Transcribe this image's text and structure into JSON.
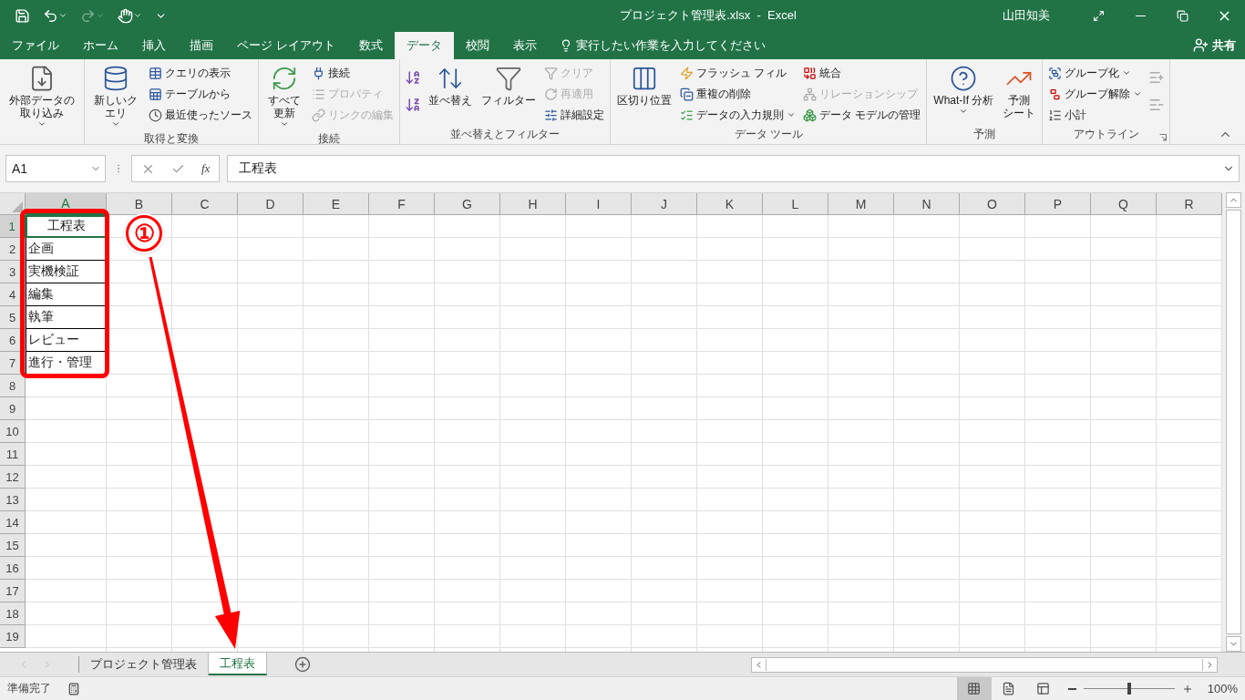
{
  "title_bar": {
    "title": "プロジェクト管理表.xlsx  -  Excel",
    "user": "山田知美",
    "redo_disabled": true
  },
  "ribbon_tabs": [
    {
      "label": "ファイル",
      "selected": false
    },
    {
      "label": "ホーム",
      "selected": false
    },
    {
      "label": "挿入",
      "selected": false
    },
    {
      "label": "描画",
      "selected": false
    },
    {
      "label": "ページ レイアウト",
      "selected": false
    },
    {
      "label": "数式",
      "selected": false
    },
    {
      "label": "データ",
      "selected": true
    },
    {
      "label": "校閲",
      "selected": false
    },
    {
      "label": "表示",
      "selected": false
    }
  ],
  "tell_me": {
    "placeholder": "実行したい作業を入力してください"
  },
  "share": "共有",
  "ribbon_groups": [
    {
      "columns": [
        [
          {
            "label": "外部データの取り込み",
            "kind": "large",
            "dropdown": true,
            "disabled": false
          }
        ]
      ]
    },
    {
      "label": "取得と変換",
      "columns": [
        [
          {
            "label": "新しいクエリ",
            "kind": "large",
            "dropdown": true,
            "disabled": false
          }
        ],
        [
          {
            "label": "クエリの表示",
            "kind": "small",
            "dropdown": false,
            "disabled": false
          },
          {
            "label": "テーブルから",
            "kind": "small",
            "dropdown": false,
            "disabled": false
          },
          {
            "label": "最近使ったソース",
            "kind": "small",
            "dropdown": false,
            "disabled": false
          }
        ]
      ]
    },
    {
      "label": "接続",
      "columns": [
        [
          {
            "label": "すべて更新",
            "kind": "large",
            "dropdown": true,
            "disabled": false
          }
        ],
        [
          {
            "label": "接続",
            "kind": "small",
            "dropdown": false,
            "disabled": false
          },
          {
            "label": "プロパティ",
            "kind": "small",
            "dropdown": false,
            "disabled": true
          },
          {
            "label": "リンクの編集",
            "kind": "small",
            "dropdown": false,
            "disabled": true
          }
        ]
      ]
    },
    {
      "label": "並べ替えとフィルター",
      "columns": [
        [
          {
            "kind": "icon",
            "disabled": false
          },
          {
            "kind": "icon",
            "disabled": false
          }
        ],
        [
          {
            "label": "並べ替え",
            "kind": "large",
            "dropdown": false,
            "disabled": false
          }
        ],
        [
          {
            "label": "フィルター",
            "kind": "large",
            "dropdown": false,
            "disabled": false
          }
        ],
        [
          {
            "label": "クリア",
            "kind": "small",
            "dropdown": false,
            "disabled": true
          },
          {
            "label": "再適用",
            "kind": "small",
            "dropdown": false,
            "disabled": true
          },
          {
            "label": "詳細設定",
            "kind": "small",
            "dropdown": false,
            "disabled": false
          }
        ]
      ]
    },
    {
      "label": "データ ツール",
      "columns": [
        [
          {
            "label": "区切り位置",
            "kind": "large",
            "dropdown": false,
            "disabled": false
          }
        ],
        [
          {
            "label": "フラッシュ フィル",
            "kind": "small",
            "dropdown": false,
            "disabled": false
          },
          {
            "label": "重複の削除",
            "kind": "small",
            "dropdown": false,
            "disabled": false
          },
          {
            "label": "データの入力規則",
            "kind": "small",
            "dropdown": true,
            "disabled": false
          }
        ],
        [
          {
            "label": "統合",
            "kind": "small",
            "dropdown": false,
            "disabled": false
          },
          {
            "label": "リレーションシップ",
            "kind": "small",
            "dropdown": false,
            "disabled": true
          },
          {
            "label": "データ モデルの管理",
            "kind": "small",
            "dropdown": false,
            "disabled": false
          }
        ]
      ]
    },
    {
      "label": "予測",
      "columns": [
        [
          {
            "label": "What-If 分析",
            "kind": "large",
            "dropdown": true,
            "disabled": false
          }
        ],
        [
          {
            "lines": [
              "予測",
              "シート"
            ],
            "kind": "large",
            "dropdown": false,
            "disabled": false
          }
        ]
      ]
    },
    {
      "label": "アウトライン",
      "launcher": true,
      "columns": [
        [
          {
            "label": "グループ化",
            "kind": "small",
            "dropdown": true,
            "disabled": false
          },
          {
            "label": "グループ解除",
            "kind": "small",
            "dropdown": true,
            "disabled": false
          },
          {
            "label": "小計",
            "kind": "small",
            "dropdown": false,
            "disabled": false
          }
        ],
        [
          {
            "kind": "icon",
            "disabled": true
          },
          {
            "kind": "icon",
            "disabled": true
          }
        ]
      ]
    }
  ],
  "formula_bar": {
    "name_box": "A1",
    "function_label": "fx",
    "formula": "工程表"
  },
  "columns": [
    {
      "label": "A",
      "selected": true
    },
    {
      "label": "B",
      "selected": false
    },
    {
      "label": "C",
      "selected": false
    },
    {
      "label": "D",
      "selected": false
    },
    {
      "label": "E",
      "selected": false
    },
    {
      "label": "F",
      "selected": false
    },
    {
      "label": "G",
      "selected": false
    },
    {
      "label": "H",
      "selected": false
    },
    {
      "label": "I",
      "selected": false
    },
    {
      "label": "J",
      "selected": false
    },
    {
      "label": "K",
      "selected": false
    },
    {
      "label": "L",
      "selected": false
    },
    {
      "label": "M",
      "selected": false
    },
    {
      "label": "N",
      "selected": false
    },
    {
      "label": "O",
      "selected": false
    },
    {
      "label": "P",
      "selected": false
    },
    {
      "label": "Q",
      "selected": false
    },
    {
      "label": "R",
      "selected": false
    }
  ],
  "rows": [
    {
      "number": "1",
      "selected": true,
      "cells": [
        {
          "text": "工程表",
          "bordered": true,
          "centered": true,
          "active": true
        }
      ]
    },
    {
      "number": "2",
      "selected": false,
      "cells": [
        {
          "text": "企画",
          "bordered": true,
          "centered": false,
          "active": false
        }
      ]
    },
    {
      "number": "3",
      "selected": false,
      "cells": [
        {
          "text": "実機検証",
          "bordered": true,
          "centered": false,
          "active": false
        }
      ]
    },
    {
      "number": "4",
      "selected": false,
      "cells": [
        {
          "text": "編集",
          "bordered": true,
          "centered": false,
          "active": false
        }
      ]
    },
    {
      "number": "5",
      "selected": false,
      "cells": [
        {
          "text": "執筆",
          "bordered": true,
          "centered": false,
          "active": false
        }
      ]
    },
    {
      "number": "6",
      "selected": false,
      "cells": [
        {
          "text": "レビュー",
          "bordered": true,
          "centered": false,
          "active": false
        }
      ]
    },
    {
      "number": "7",
      "selected": false,
      "cells": [
        {
          "text": "進行・管理",
          "bordered": true,
          "centered": false,
          "active": false
        }
      ]
    },
    {
      "number": "8",
      "selected": false,
      "cells": []
    },
    {
      "number": "9",
      "selected": false,
      "cells": []
    },
    {
      "number": "10",
      "selected": false,
      "cells": []
    },
    {
      "number": "11",
      "selected": false,
      "cells": []
    },
    {
      "number": "12",
      "selected": false,
      "cells": []
    },
    {
      "number": "13",
      "selected": false,
      "cells": []
    },
    {
      "number": "14",
      "selected": false,
      "cells": []
    },
    {
      "number": "15",
      "selected": false,
      "cells": []
    },
    {
      "number": "16",
      "selected": false,
      "cells": []
    },
    {
      "number": "17",
      "selected": false,
      "cells": []
    },
    {
      "number": "18",
      "selected": false,
      "cells": []
    },
    {
      "number": "19",
      "selected": false,
      "cells": []
    }
  ],
  "annotation": {
    "label": "①"
  },
  "sheet_tabs": [
    {
      "label": "プロジェクト管理表",
      "selected": false
    },
    {
      "label": "工程表",
      "selected": true
    }
  ],
  "status_bar": {
    "status": "準備完了",
    "views": [
      {
        "selected": true
      },
      {
        "selected": false
      },
      {
        "selected": false
      }
    ],
    "zoom": {
      "level": 0.5,
      "reading": "100%"
    }
  }
}
